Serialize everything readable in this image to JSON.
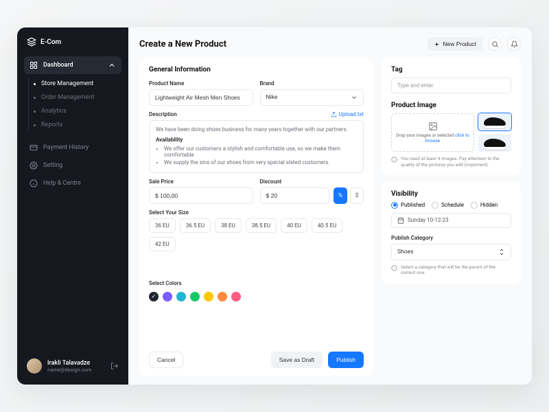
{
  "brand": "E-Com",
  "sidebar": {
    "dashboard": "Dashboard",
    "items": [
      "Store Management",
      "Order Management",
      "Analytics",
      "Reports"
    ],
    "payment": "Payment History",
    "setting": "Setting",
    "help": "Help & Centre"
  },
  "user": {
    "name": "Irakli Talavadze",
    "email": "name@design.com"
  },
  "page_title": "Create a New Product",
  "new_product_btn": "New Product",
  "general": {
    "title": "General Information",
    "product_name_label": "Product Name",
    "product_name": "Lightweight Air Mesh Men Shoes",
    "brand_label": "Brand",
    "brand": "Nike",
    "description_label": "Description",
    "upload_link": "Upload.txt",
    "description_intro": "We have been doing shoes business for many years together with our partners.",
    "availability_label": "Availability",
    "availability_items": [
      "We offer our customers a stylish and comfortable use, so we make them comfortable",
      "We supply the sins of our shoes from very special sleted customers."
    ],
    "sale_price_label": "Sale Price",
    "sale_price": "$ 100,00",
    "discount_label": "Discount",
    "discount": "$ 20",
    "pct": "%",
    "dollar": "$",
    "size_label": "Select Your Size",
    "sizes": [
      "36 EU",
      "36.5 EU",
      "38 EU",
      "38.5 EU",
      "40 EU",
      "40.5 EU",
      "42 EU"
    ],
    "colors_label": "Select Colors",
    "colors": [
      "#1f2430",
      "#7c5cff",
      "#1fb6d1",
      "#18c767",
      "#ffc700",
      "#ff8a3d",
      "#ff5b85"
    ]
  },
  "tag": {
    "title": "Tag",
    "placeholder": "Type and enter"
  },
  "image": {
    "title": "Product Image",
    "drop_text": "Drop your images or selected",
    "browse": "click to browse",
    "hint": "You need at least 4 images. Pay attention to the quality of the pictures you add (important)"
  },
  "visibility": {
    "title": "Visibility",
    "options": [
      "Published",
      "Schedule",
      "Hidden"
    ],
    "date": "Sunday 10-12-23",
    "category_label": "Publish Category",
    "category": "Shoes",
    "category_hint": "Select a category that will be the parent of the current one."
  },
  "buttons": {
    "cancel": "Cancel",
    "draft": "Save as Draft",
    "publish": "Publish"
  }
}
